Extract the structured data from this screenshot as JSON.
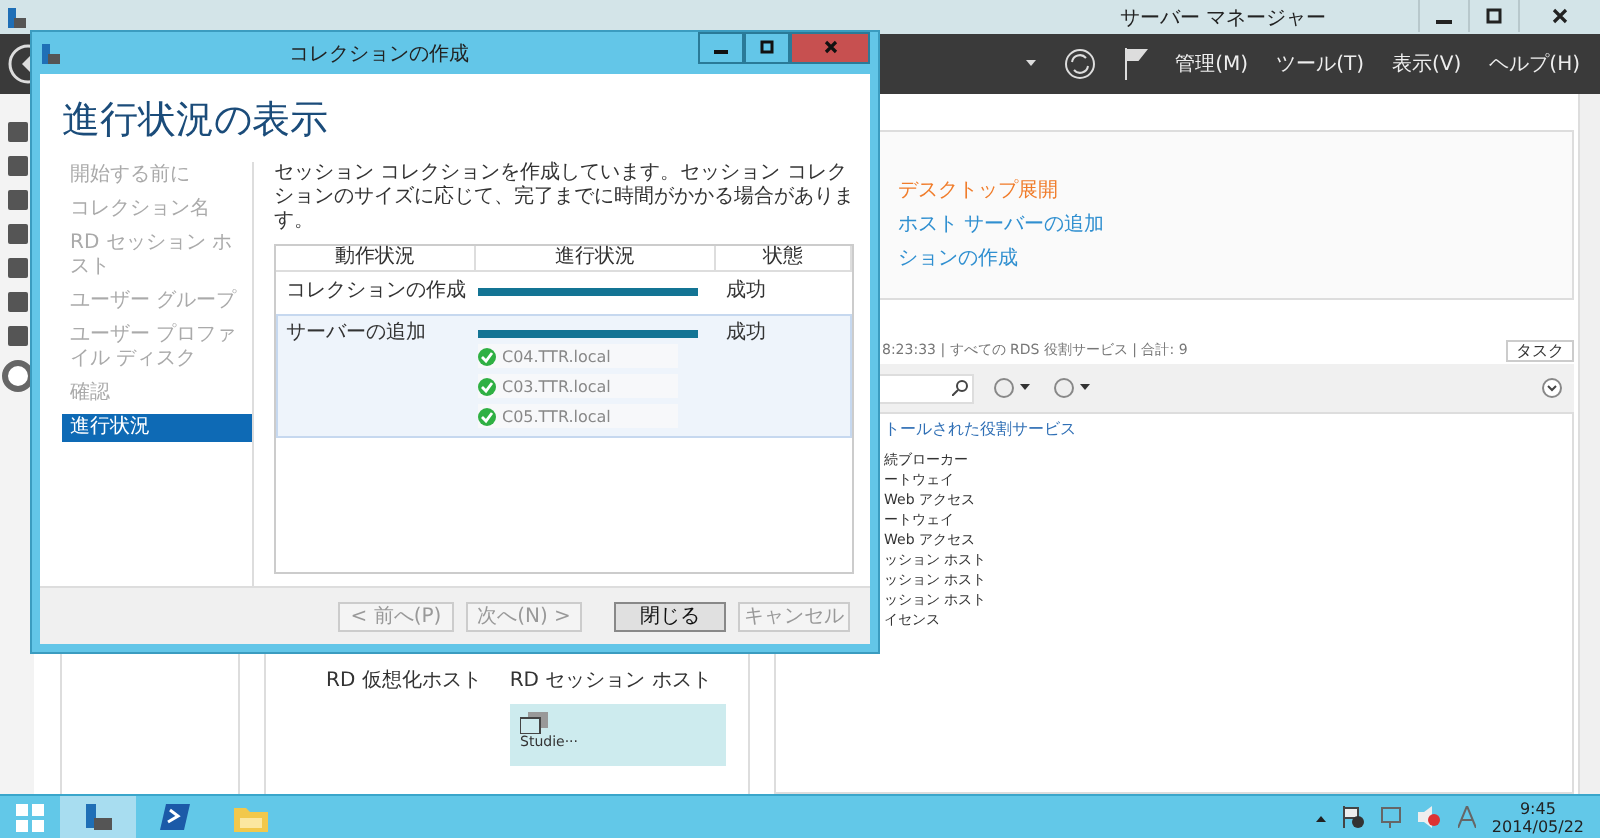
{
  "background_window": {
    "title": "サーバー マネージャー",
    "menu": [
      "管理(M)",
      "ツール(T)",
      "表示(V)",
      "ヘルプ(H)"
    ],
    "links": [
      {
        "label": "デスクトップ展開",
        "kind": "current"
      },
      {
        "label": "ホスト サーバーの追加",
        "kind": "link"
      },
      {
        "label": "ションの作成",
        "kind": "link"
      }
    ],
    "services": {
      "summary": "8:23:33 | すべての RDS 役割サービス | 合計: 9",
      "task_button": "タスク",
      "group_header": "トールされた役割サービス",
      "items": [
        "続ブローカー",
        "ートウェイ",
        "Web アクセス",
        "ートウェイ",
        "Web アクセス",
        "ッション ホスト",
        "ッション ホスト",
        "ッション ホスト",
        "イセンス"
      ]
    },
    "diagram": {
      "labels": [
        "RD 仮想化ホスト",
        "RD セッション ホスト"
      ],
      "server_tile": "Studie···"
    }
  },
  "dialog": {
    "title": "コレクションの作成",
    "heading": "進行状況の表示",
    "steps": [
      {
        "label": "開始する前に",
        "selected": false
      },
      {
        "label": "コレクション名",
        "selected": false
      },
      {
        "label": "RD セッション ホスト",
        "selected": false
      },
      {
        "label": "ユーザー グループ",
        "selected": false
      },
      {
        "label": "ユーザー プロファイル ディスク",
        "selected": false
      },
      {
        "label": "確認",
        "selected": false
      },
      {
        "label": "進行状況",
        "selected": true
      }
    ],
    "description": "セッション コレクションを作成しています。セッション コレクションのサイズに応じて、完了までに時間がかかる場合があります。",
    "table": {
      "columns": [
        "動作状況",
        "進行状況",
        "状態"
      ],
      "rows": [
        {
          "action": "コレクションの作成",
          "level": 1,
          "status": "成功",
          "selected": false,
          "servers": []
        },
        {
          "action": "サーバーの追加",
          "level": 1,
          "status": "成功",
          "selected": true,
          "servers": [
            "C04.TTR.local",
            "C03.TTR.local",
            "C05.TTR.local"
          ]
        }
      ]
    },
    "buttons": [
      {
        "label": "< 前へ(P)",
        "disabled": true
      },
      {
        "label": "次へ(N) >",
        "disabled": true
      },
      {
        "label": "閉じる",
        "disabled": false
      },
      {
        "label": "キャンセル",
        "disabled": true
      }
    ]
  },
  "taskbar": {
    "apps": [
      {
        "kind": "server-manager",
        "selected": true
      },
      {
        "kind": "powershell",
        "selected": false
      },
      {
        "kind": "explorer",
        "selected": false
      }
    ],
    "time": "9:45",
    "date": "2014/05/22"
  }
}
